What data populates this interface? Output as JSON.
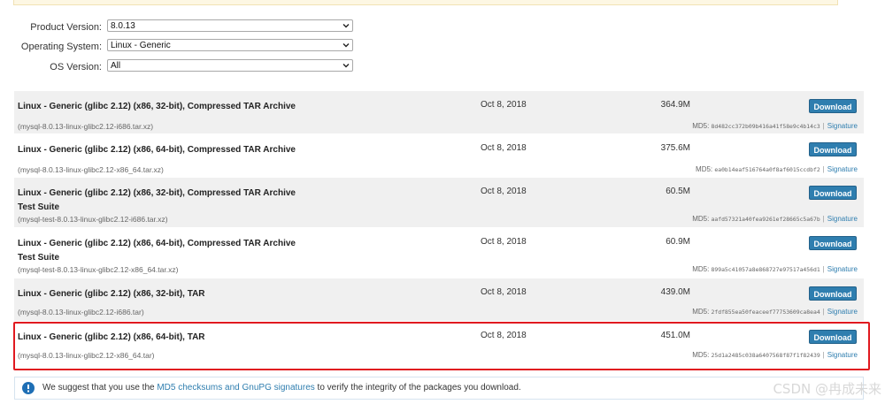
{
  "form": {
    "product_version": {
      "label": "Product Version:",
      "value": "8.0.13"
    },
    "operating_system": {
      "label": "Operating System:",
      "value": "Linux - Generic"
    },
    "os_version": {
      "label": "OS Version:",
      "value": "All"
    }
  },
  "downloads": [
    {
      "name_line1": "Linux - Generic (glibc 2.12) (x86, 32-bit), Compressed TAR Archive",
      "name_line2": "",
      "file": "(mysql-8.0.13-linux-glibc2.12-i686.tar.xz)",
      "date": "Oct 8, 2018",
      "size": "364.9M",
      "button": "Download",
      "md5_label": "MD5:",
      "md5": "8d482cc372b09b416a41f58e9c4b14c3",
      "signature": "Signature"
    },
    {
      "name_line1": "Linux - Generic (glibc 2.12) (x86, 64-bit), Compressed TAR Archive",
      "name_line2": "",
      "file": "(mysql-8.0.13-linux-glibc2.12-x86_64.tar.xz)",
      "date": "Oct 8, 2018",
      "size": "375.6M",
      "button": "Download",
      "md5_label": "MD5:",
      "md5": "ea0b14eaf516764a0f8af6015ccdbf2",
      "signature": "Signature"
    },
    {
      "name_line1": "Linux - Generic (glibc 2.12) (x86, 32-bit), Compressed TAR Archive",
      "name_line2": "Test Suite",
      "file": "(mysql-test-8.0.13-linux-glibc2.12-i686.tar.xz)",
      "date": "Oct 8, 2018",
      "size": "60.5M",
      "button": "Download",
      "md5_label": "MD5:",
      "md5": "aafd57321a40fea9261ef28665c5a67b",
      "signature": "Signature"
    },
    {
      "name_line1": "Linux - Generic (glibc 2.12) (x86, 64-bit), Compressed TAR Archive",
      "name_line2": "Test Suite",
      "file": "(mysql-test-8.0.13-linux-glibc2.12-x86_64.tar.xz)",
      "date": "Oct 8, 2018",
      "size": "60.9M",
      "button": "Download",
      "md5_label": "MD5:",
      "md5": "899a5c41057a8e868727e97517a456d1",
      "signature": "Signature"
    },
    {
      "name_line1": "Linux - Generic (glibc 2.12) (x86, 32-bit), TAR",
      "name_line2": "",
      "file": "(mysql-8.0.13-linux-glibc2.12-i686.tar)",
      "date": "Oct 8, 2018",
      "size": "439.0M",
      "button": "Download",
      "md5_label": "MD5:",
      "md5": "2fdf855ea50feaceef77753609ca8ea4",
      "signature": "Signature"
    },
    {
      "name_line1": "Linux - Generic (glibc 2.12) (x86, 64-bit), TAR",
      "name_line2": "",
      "file": "(mysql-8.0.13-linux-glibc2.12-x86_64.tar)",
      "date": "Oct 8, 2018",
      "size": "451.0M",
      "button": "Download",
      "md5_label": "MD5:",
      "md5": "25d1a2485c038a6407568f87f1f82439",
      "signature": "Signature"
    }
  ],
  "notice": {
    "prefix": "We suggest that you use the ",
    "link": "MD5 checksums and GnuPG signatures",
    "suffix": " to verify the integrity of the packages you download."
  },
  "watermark": "CSDN @冉成未来",
  "colors": {
    "button": "#2f7eaf",
    "row_gray": "#f0f0f0",
    "highlight": "#e0191f",
    "link": "#2f7eaf"
  }
}
